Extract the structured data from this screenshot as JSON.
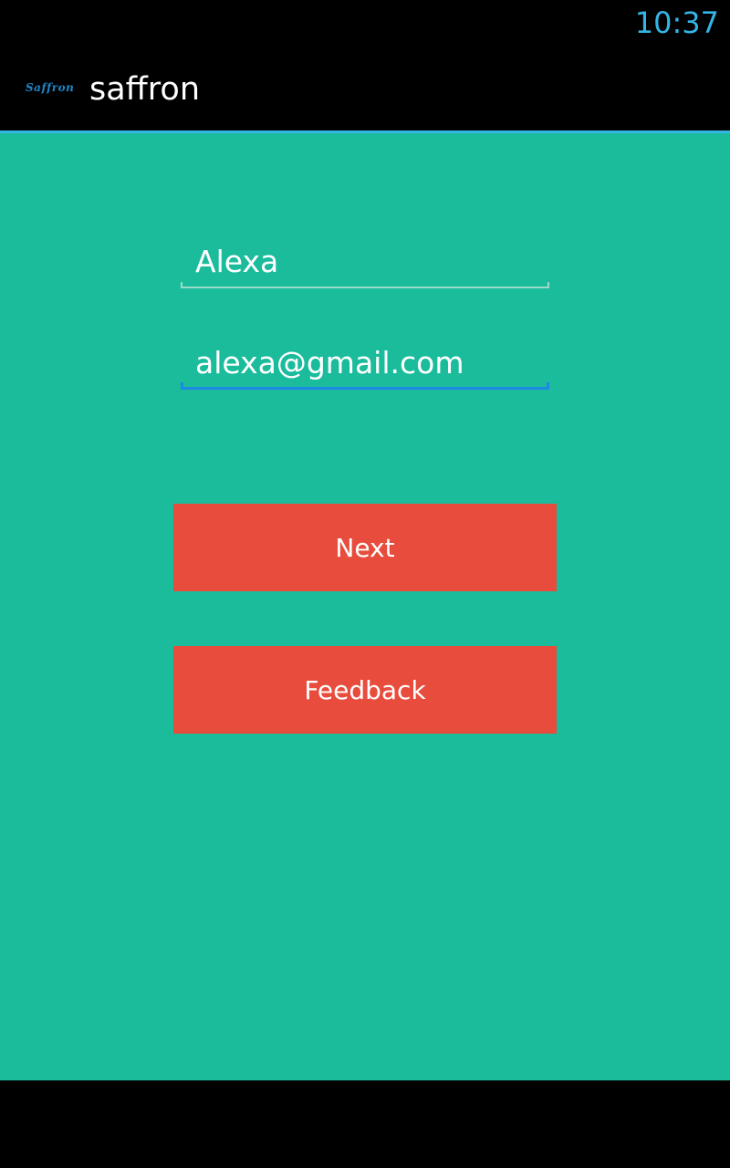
{
  "status_bar": {
    "time": "10:37"
  },
  "action_bar": {
    "logo_text": "Saffron",
    "title": "saffron"
  },
  "form": {
    "name_value": "Alexa",
    "email_value": "alexa@gmail.com"
  },
  "buttons": {
    "next_label": "Next",
    "feedback_label": "Feedback"
  },
  "colors": {
    "background": "#1abc9c",
    "button": "#e74c3c",
    "accent": "#33b5e5"
  }
}
